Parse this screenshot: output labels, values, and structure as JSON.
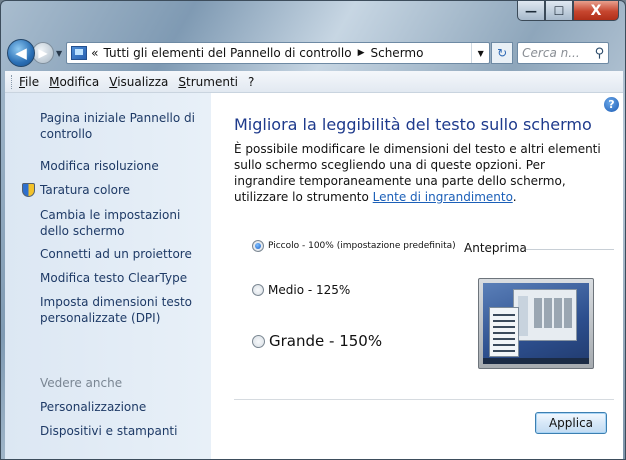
{
  "window": {
    "caption_min": "—",
    "caption_max": "☐",
    "caption_close": "X"
  },
  "nav": {
    "back_glyph": "◀",
    "forward_glyph": "▶",
    "history_glyph": "▼",
    "address_prefix": "«",
    "address_part1": "Tutti gli elementi del Pannello di controllo",
    "address_separator": "▶",
    "address_part2": "Schermo",
    "address_dropdown_glyph": "▼",
    "refresh_glyph": "↻",
    "search_placeholder": "Cerca n...",
    "search_glyph": "⚲"
  },
  "menubar": {
    "items": [
      {
        "label": "File"
      },
      {
        "label": "Modifica"
      },
      {
        "label": "Visualizza"
      },
      {
        "label": "Strumenti"
      },
      {
        "label": "?"
      }
    ]
  },
  "sidebar": {
    "home": "Pagina iniziale Pannello di controllo",
    "links": [
      "Modifica risoluzione",
      "Taratura colore",
      "Cambia le impostazioni dello schermo",
      "Connetti ad un proiettore",
      "Modifica testo ClearType",
      "Imposta dimensioni testo personalizzate (DPI)"
    ],
    "see_also": "Vedere anche",
    "see_also_links": [
      "Personalizzazione",
      "Dispositivi e stampanti"
    ]
  },
  "main": {
    "help_glyph": "?",
    "title": "Migliora la leggibilità del testo sullo schermo",
    "description": "È possibile modificare le dimensioni del testo e altri elementi sullo schermo scegliendo una di queste opzioni. Per ingrandire temporaneamente una parte dello schermo, utilizzare lo strumento",
    "magnifier_link": "Lente di ingrandimento",
    "description_end": ".",
    "options": [
      {
        "label": "Piccolo - 100% (impostazione predefinita)",
        "selected": true
      },
      {
        "label": "Medio - 125%",
        "selected": false
      },
      {
        "label": "Grande - 150%",
        "selected": false
      }
    ],
    "preview_label": "Anteprima",
    "apply_label": "Applica"
  }
}
